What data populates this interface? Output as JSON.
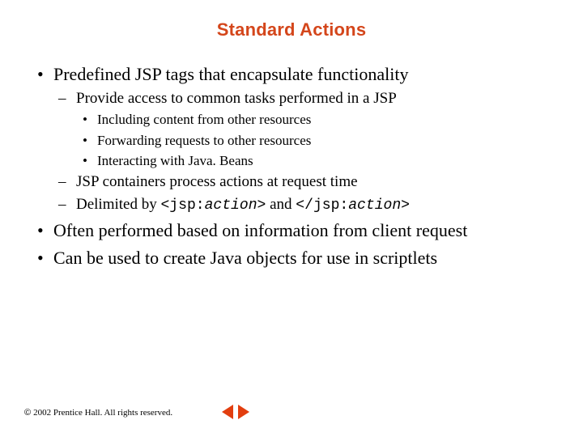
{
  "title": "Standard Actions",
  "bullets": {
    "b1": "Predefined JSP tags that encapsulate functionality",
    "b1_1": "Provide access to common tasks performed in a JSP",
    "b1_1_1": "Including content from other resources",
    "b1_1_2": "Forwarding requests to other resources",
    "b1_1_3": "Interacting with Java. Beans",
    "b1_2": "JSP containers process actions at request time",
    "b1_3_pre": "Delimited by ",
    "b1_3_open1": "<jsp:",
    "b1_3_action": "action",
    "b1_3_close1": ">",
    "b1_3_and": " and ",
    "b1_3_open2": "</jsp:",
    "b1_3_close2": ">",
    "b2": "Often performed based on information from client request",
    "b3": "Can be used to create Java objects for use in scriptlets"
  },
  "footer": {
    "symbol": "©",
    "text": "2002 Prentice Hall. All rights reserved."
  }
}
